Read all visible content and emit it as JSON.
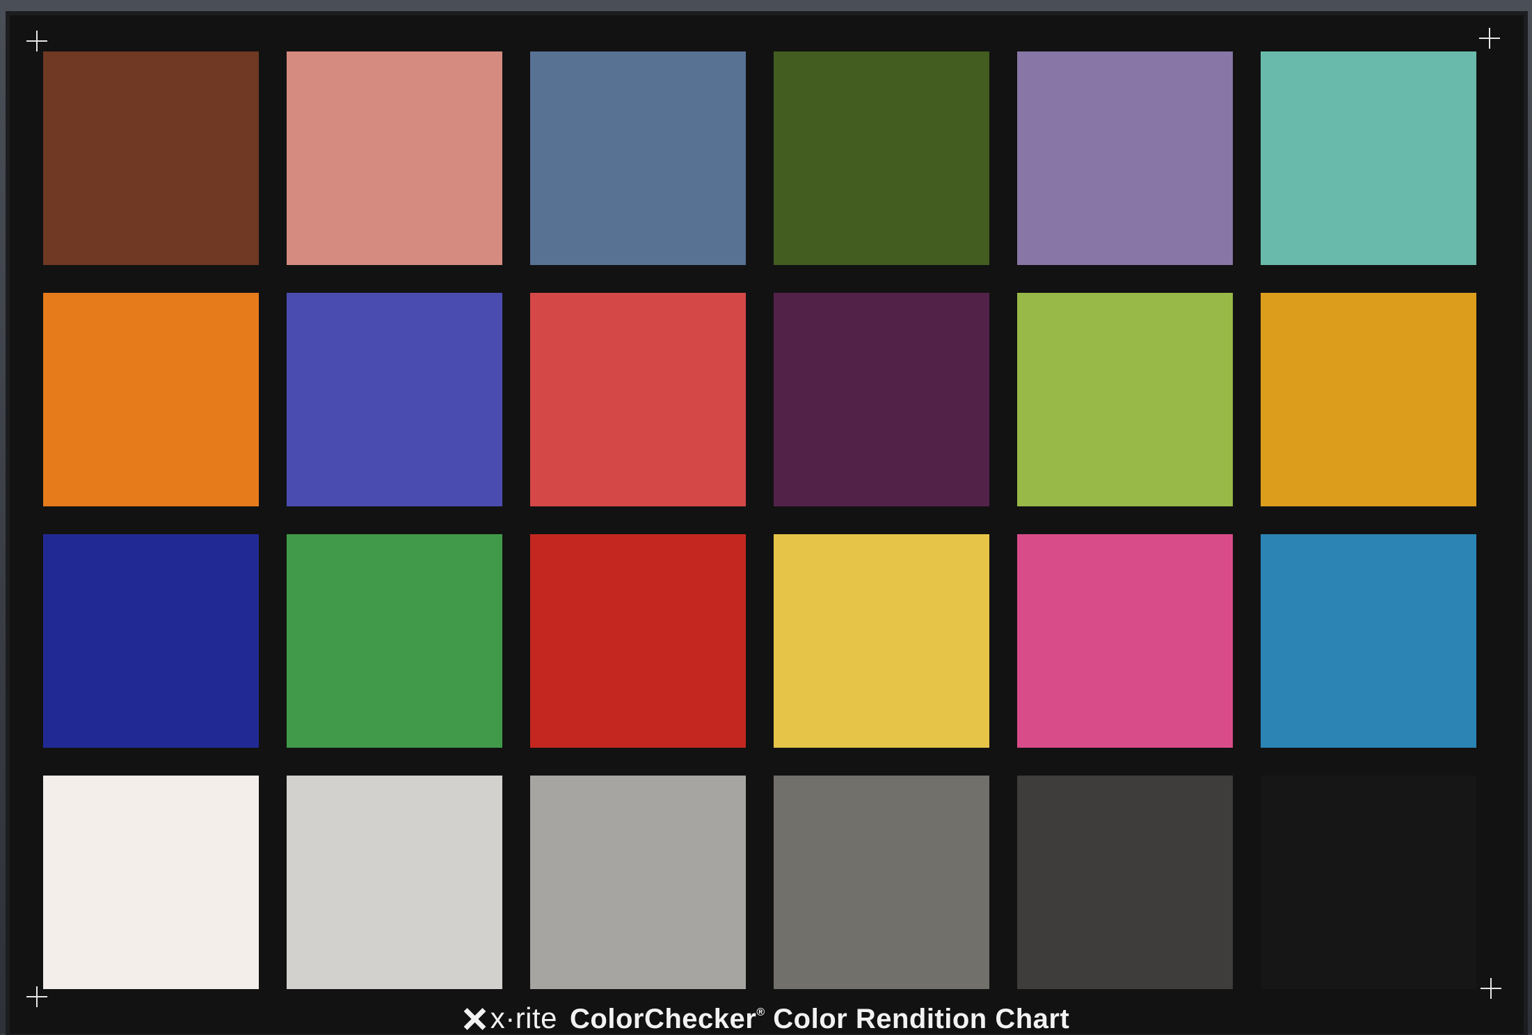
{
  "chart": {
    "patches": [
      {
        "color": "#6f3923"
      },
      {
        "color": "#d58b7f"
      },
      {
        "color": "#587294"
      },
      {
        "color": "#435d20"
      },
      {
        "color": "#8876a6"
      },
      {
        "color": "#6abaab"
      },
      {
        "color": "#e67b1c"
      },
      {
        "color": "#4b4cb0"
      },
      {
        "color": "#d54848"
      },
      {
        "color": "#532249"
      },
      {
        "color": "#98b947"
      },
      {
        "color": "#dc9d1c"
      },
      {
        "color": "#212a94"
      },
      {
        "color": "#409a49"
      },
      {
        "color": "#c42720"
      },
      {
        "color": "#e6c448"
      },
      {
        "color": "#d94c8a"
      },
      {
        "color": "#2b84b3"
      },
      {
        "color": "#f3eeea"
      },
      {
        "color": "#d3d1cd"
      },
      {
        "color": "#a7a5a1"
      },
      {
        "color": "#72706b"
      },
      {
        "color": "#3e3d3b"
      },
      {
        "color": "#161616"
      }
    ]
  },
  "caption": {
    "brand": "x·rite",
    "product": "ColorChecker",
    "registered": "®",
    "subtitle": " Color Rendition Chart"
  }
}
